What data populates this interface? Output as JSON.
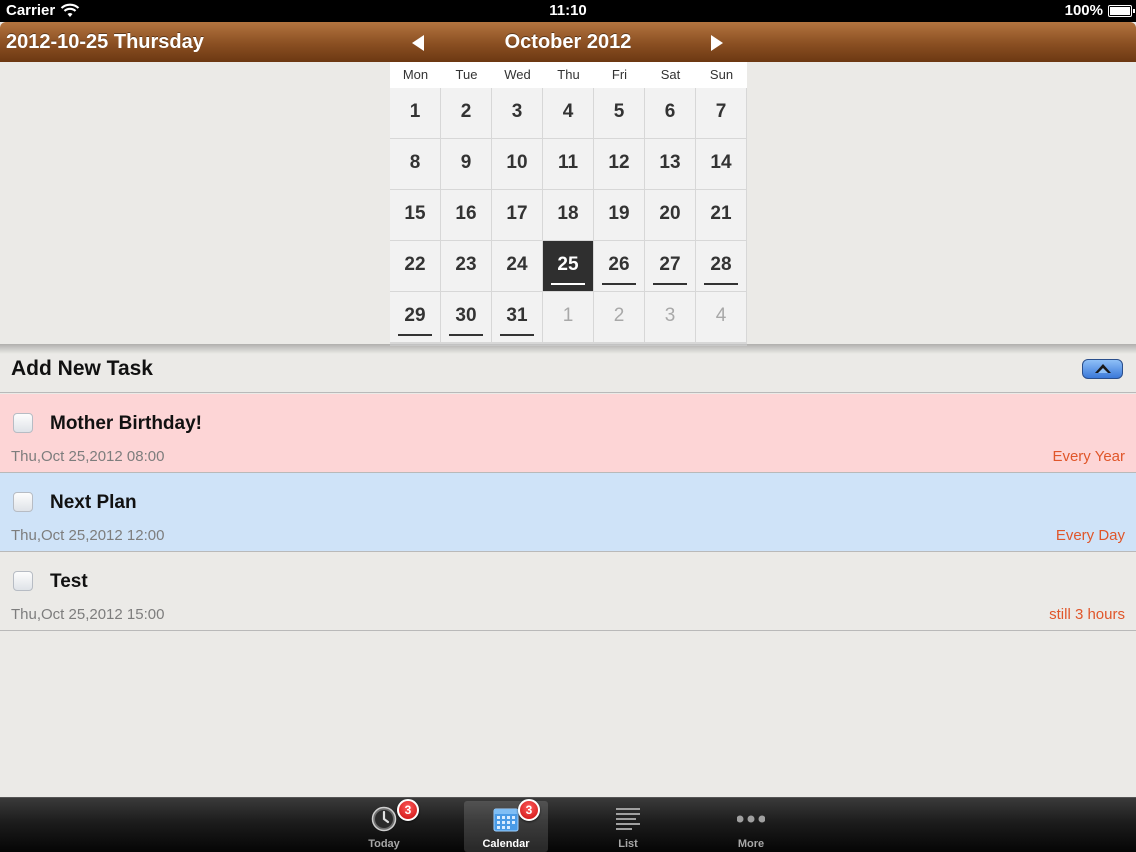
{
  "status_bar": {
    "carrier": "Carrier",
    "time": "11:10",
    "battery": "100%"
  },
  "header": {
    "selected_date": "2012-10-25 Thursday",
    "month_title": "October 2012"
  },
  "calendar": {
    "weekdays": [
      "Mon",
      "Tue",
      "Wed",
      "Thu",
      "Fri",
      "Sat",
      "Sun"
    ],
    "days": [
      {
        "label": "1",
        "current": true,
        "marked": false,
        "selected": false
      },
      {
        "label": "2",
        "current": true,
        "marked": false,
        "selected": false
      },
      {
        "label": "3",
        "current": true,
        "marked": false,
        "selected": false
      },
      {
        "label": "4",
        "current": true,
        "marked": false,
        "selected": false
      },
      {
        "label": "5",
        "current": true,
        "marked": false,
        "selected": false
      },
      {
        "label": "6",
        "current": true,
        "marked": false,
        "selected": false
      },
      {
        "label": "7",
        "current": true,
        "marked": false,
        "selected": false
      },
      {
        "label": "8",
        "current": true,
        "marked": false,
        "selected": false
      },
      {
        "label": "9",
        "current": true,
        "marked": false,
        "selected": false
      },
      {
        "label": "10",
        "current": true,
        "marked": false,
        "selected": false
      },
      {
        "label": "11",
        "current": true,
        "marked": false,
        "selected": false
      },
      {
        "label": "12",
        "current": true,
        "marked": false,
        "selected": false
      },
      {
        "label": "13",
        "current": true,
        "marked": false,
        "selected": false
      },
      {
        "label": "14",
        "current": true,
        "marked": false,
        "selected": false
      },
      {
        "label": "15",
        "current": true,
        "marked": false,
        "selected": false
      },
      {
        "label": "16",
        "current": true,
        "marked": false,
        "selected": false
      },
      {
        "label": "17",
        "current": true,
        "marked": false,
        "selected": false
      },
      {
        "label": "18",
        "current": true,
        "marked": false,
        "selected": false
      },
      {
        "label": "19",
        "current": true,
        "marked": false,
        "selected": false
      },
      {
        "label": "20",
        "current": true,
        "marked": false,
        "selected": false
      },
      {
        "label": "21",
        "current": true,
        "marked": false,
        "selected": false
      },
      {
        "label": "22",
        "current": true,
        "marked": false,
        "selected": false
      },
      {
        "label": "23",
        "current": true,
        "marked": false,
        "selected": false
      },
      {
        "label": "24",
        "current": true,
        "marked": false,
        "selected": false
      },
      {
        "label": "25",
        "current": true,
        "marked": true,
        "selected": true
      },
      {
        "label": "26",
        "current": true,
        "marked": true,
        "selected": false
      },
      {
        "label": "27",
        "current": true,
        "marked": true,
        "selected": false
      },
      {
        "label": "28",
        "current": true,
        "marked": true,
        "selected": false
      },
      {
        "label": "29",
        "current": true,
        "marked": true,
        "selected": false
      },
      {
        "label": "30",
        "current": true,
        "marked": true,
        "selected": false
      },
      {
        "label": "31",
        "current": true,
        "marked": true,
        "selected": false
      },
      {
        "label": "1",
        "current": false,
        "marked": false,
        "selected": false
      },
      {
        "label": "2",
        "current": false,
        "marked": false,
        "selected": false
      },
      {
        "label": "3",
        "current": false,
        "marked": false,
        "selected": false
      },
      {
        "label": "4",
        "current": false,
        "marked": false,
        "selected": false
      }
    ]
  },
  "add_task": {
    "title": "Add New Task"
  },
  "tasks": [
    {
      "name": "Mother Birthday!",
      "datetime": "Thu,Oct 25,2012 08:00",
      "repeat": "Every Year",
      "color": "#fdd5d6"
    },
    {
      "name": "Next Plan",
      "datetime": "Thu,Oct 25,2012 12:00",
      "repeat": "Every Day",
      "color": "#cfe3f8"
    },
    {
      "name": "Test",
      "datetime": "Thu,Oct 25,2012 15:00",
      "repeat": "still 3 hours",
      "color": "#ebeae7"
    }
  ],
  "tabs": [
    {
      "label": "Today",
      "icon": "clock-icon",
      "badge": "3",
      "active": false
    },
    {
      "label": "Calendar",
      "icon": "calendar-icon",
      "badge": "3",
      "active": true
    },
    {
      "label": "List",
      "icon": "list-icon",
      "badge": "",
      "active": false
    },
    {
      "label": "More",
      "icon": "more-icon",
      "badge": "",
      "active": false
    }
  ]
}
